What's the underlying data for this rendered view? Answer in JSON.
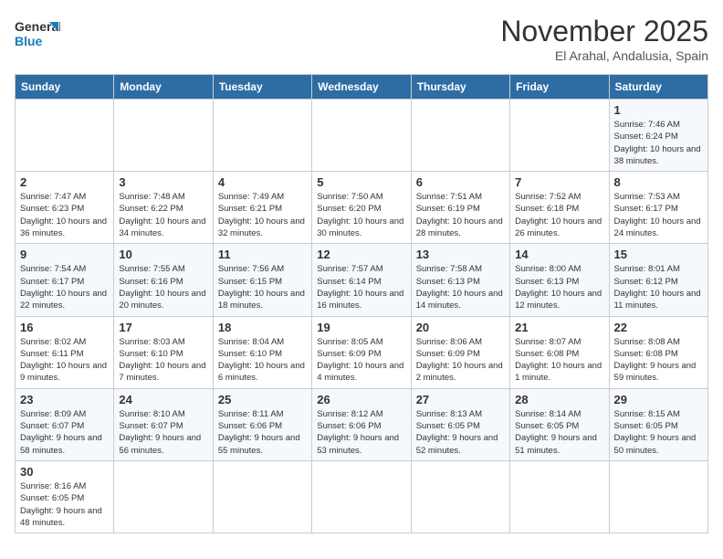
{
  "logo": {
    "text_general": "General",
    "text_blue": "Blue"
  },
  "title": "November 2025",
  "subtitle": "El Arahal, Andalusia, Spain",
  "weekdays": [
    "Sunday",
    "Monday",
    "Tuesday",
    "Wednesday",
    "Thursday",
    "Friday",
    "Saturday"
  ],
  "weeks": [
    [
      {
        "day": "",
        "info": ""
      },
      {
        "day": "",
        "info": ""
      },
      {
        "day": "",
        "info": ""
      },
      {
        "day": "",
        "info": ""
      },
      {
        "day": "",
        "info": ""
      },
      {
        "day": "",
        "info": ""
      },
      {
        "day": "1",
        "info": "Sunrise: 7:46 AM\nSunset: 6:24 PM\nDaylight: 10 hours and 38 minutes."
      }
    ],
    [
      {
        "day": "2",
        "info": "Sunrise: 7:47 AM\nSunset: 6:23 PM\nDaylight: 10 hours and 36 minutes."
      },
      {
        "day": "3",
        "info": "Sunrise: 7:48 AM\nSunset: 6:22 PM\nDaylight: 10 hours and 34 minutes."
      },
      {
        "day": "4",
        "info": "Sunrise: 7:49 AM\nSunset: 6:21 PM\nDaylight: 10 hours and 32 minutes."
      },
      {
        "day": "5",
        "info": "Sunrise: 7:50 AM\nSunset: 6:20 PM\nDaylight: 10 hours and 30 minutes."
      },
      {
        "day": "6",
        "info": "Sunrise: 7:51 AM\nSunset: 6:19 PM\nDaylight: 10 hours and 28 minutes."
      },
      {
        "day": "7",
        "info": "Sunrise: 7:52 AM\nSunset: 6:18 PM\nDaylight: 10 hours and 26 minutes."
      },
      {
        "day": "8",
        "info": "Sunrise: 7:53 AM\nSunset: 6:17 PM\nDaylight: 10 hours and 24 minutes."
      }
    ],
    [
      {
        "day": "9",
        "info": "Sunrise: 7:54 AM\nSunset: 6:17 PM\nDaylight: 10 hours and 22 minutes."
      },
      {
        "day": "10",
        "info": "Sunrise: 7:55 AM\nSunset: 6:16 PM\nDaylight: 10 hours and 20 minutes."
      },
      {
        "day": "11",
        "info": "Sunrise: 7:56 AM\nSunset: 6:15 PM\nDaylight: 10 hours and 18 minutes."
      },
      {
        "day": "12",
        "info": "Sunrise: 7:57 AM\nSunset: 6:14 PM\nDaylight: 10 hours and 16 minutes."
      },
      {
        "day": "13",
        "info": "Sunrise: 7:58 AM\nSunset: 6:13 PM\nDaylight: 10 hours and 14 minutes."
      },
      {
        "day": "14",
        "info": "Sunrise: 8:00 AM\nSunset: 6:13 PM\nDaylight: 10 hours and 12 minutes."
      },
      {
        "day": "15",
        "info": "Sunrise: 8:01 AM\nSunset: 6:12 PM\nDaylight: 10 hours and 11 minutes."
      }
    ],
    [
      {
        "day": "16",
        "info": "Sunrise: 8:02 AM\nSunset: 6:11 PM\nDaylight: 10 hours and 9 minutes."
      },
      {
        "day": "17",
        "info": "Sunrise: 8:03 AM\nSunset: 6:10 PM\nDaylight: 10 hours and 7 minutes."
      },
      {
        "day": "18",
        "info": "Sunrise: 8:04 AM\nSunset: 6:10 PM\nDaylight: 10 hours and 6 minutes."
      },
      {
        "day": "19",
        "info": "Sunrise: 8:05 AM\nSunset: 6:09 PM\nDaylight: 10 hours and 4 minutes."
      },
      {
        "day": "20",
        "info": "Sunrise: 8:06 AM\nSunset: 6:09 PM\nDaylight: 10 hours and 2 minutes."
      },
      {
        "day": "21",
        "info": "Sunrise: 8:07 AM\nSunset: 6:08 PM\nDaylight: 10 hours and 1 minute."
      },
      {
        "day": "22",
        "info": "Sunrise: 8:08 AM\nSunset: 6:08 PM\nDaylight: 9 hours and 59 minutes."
      }
    ],
    [
      {
        "day": "23",
        "info": "Sunrise: 8:09 AM\nSunset: 6:07 PM\nDaylight: 9 hours and 58 minutes."
      },
      {
        "day": "24",
        "info": "Sunrise: 8:10 AM\nSunset: 6:07 PM\nDaylight: 9 hours and 56 minutes."
      },
      {
        "day": "25",
        "info": "Sunrise: 8:11 AM\nSunset: 6:06 PM\nDaylight: 9 hours and 55 minutes."
      },
      {
        "day": "26",
        "info": "Sunrise: 8:12 AM\nSunset: 6:06 PM\nDaylight: 9 hours and 53 minutes."
      },
      {
        "day": "27",
        "info": "Sunrise: 8:13 AM\nSunset: 6:05 PM\nDaylight: 9 hours and 52 minutes."
      },
      {
        "day": "28",
        "info": "Sunrise: 8:14 AM\nSunset: 6:05 PM\nDaylight: 9 hours and 51 minutes."
      },
      {
        "day": "29",
        "info": "Sunrise: 8:15 AM\nSunset: 6:05 PM\nDaylight: 9 hours and 50 minutes."
      }
    ],
    [
      {
        "day": "30",
        "info": "Sunrise: 8:16 AM\nSunset: 6:05 PM\nDaylight: 9 hours and 48 minutes."
      },
      {
        "day": "",
        "info": ""
      },
      {
        "day": "",
        "info": ""
      },
      {
        "day": "",
        "info": ""
      },
      {
        "day": "",
        "info": ""
      },
      {
        "day": "",
        "info": ""
      },
      {
        "day": "",
        "info": ""
      }
    ]
  ]
}
